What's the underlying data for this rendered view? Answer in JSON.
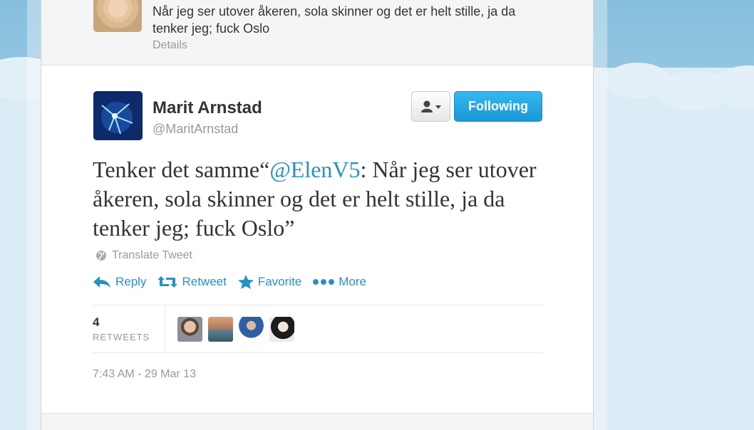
{
  "previous_tweet": {
    "text": "Når jeg ser utover åkeren, sola skinner og det er helt stille, ja da tenker jeg; fuck Oslo",
    "details_label": "Details"
  },
  "tweet": {
    "author_name": "Marit Arnstad",
    "author_handle": "@MaritArnstad",
    "text_before": "Tenker det samme“",
    "mention": "@ElenV5",
    "text_after": ": Når jeg ser utover åkeren, sola skinner og det er helt stille, ja da tenker jeg; fuck Oslo”",
    "translate_label": "Translate Tweet",
    "timestamp": "7:43 AM - 29 Mar 13"
  },
  "buttons": {
    "following_label": "Following"
  },
  "actions": {
    "reply": "Reply",
    "retweet": "Retweet",
    "favorite": "Favorite",
    "more": "More"
  },
  "stats": {
    "retweet_count": "4",
    "retweet_label": "RETWEETS"
  },
  "colors": {
    "link": "#2a8fc4",
    "follow_button": "#1c97d6",
    "text": "#333333",
    "muted": "#999999"
  }
}
